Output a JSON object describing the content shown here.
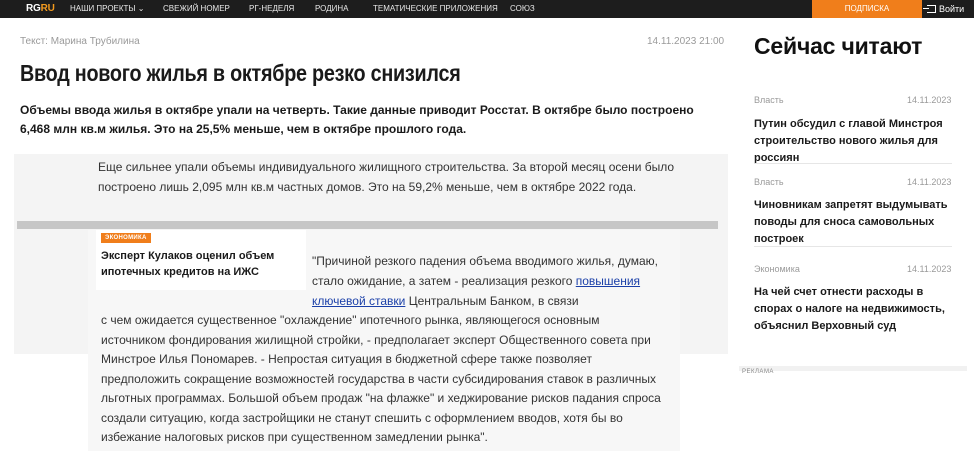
{
  "topnav": {
    "logo_main": "RG",
    "logo_suffix": "RU",
    "items": [
      {
        "label": "НАШИ ПРОЕКТЫ ⌄"
      },
      {
        "label": "СВЕЖИЙ НОМЕР"
      },
      {
        "label": "РГ-НЕДЕЛЯ"
      },
      {
        "label": "РОДИНА"
      },
      {
        "label": "ТЕМАТИЧЕСКИЕ ПРИЛОЖЕНИЯ"
      },
      {
        "label": "СОЮЗ"
      }
    ],
    "subscribe_label": "ПОДПИСКА",
    "login_label": "Войти",
    "colors": {
      "bar": "#1d1d1d",
      "accent": "#f07e1b"
    }
  },
  "article": {
    "author": "Текст: Марина Трубилина",
    "date": "14.11.2023 21:00",
    "title": "Ввод нового жилья в октябре резко снизился",
    "lead": "Объемы ввода жилья в октябре упали на четверть. Такие данные приводит Росстат. В октябре было построено 6,468 млн кв.м жилья. Это на 25,5% меньше, чем в октябре прошлого года.",
    "paragraph1": "Еще сильнее упали объемы индивидуального жилищного строительства. За второй месяц осени было построено лишь 2,095 млн кв.м частных домов. Это на 59,2% меньше, чем в октябре 2022 года.",
    "related": {
      "tag": "ЭКОНОМИКА",
      "title": "Эксперт Кулаков оценил объем ипотечных кредитов на ИЖС"
    },
    "quote_part1": "\"Причиной резкого падения объема вводимого жилья, думаю, стало ожидание, а затем - реализация резкого ",
    "quote_link": "повышения ключевой ставки",
    "quote_part2": " Центральным Банком, в связи",
    "quote_rest": "с чем ожидается существенное \"охлаждение\" ипотечного рынка, являющегося основным источником фондирования жилищной стройки, - предполагает эксперт Общественного совета при Минстрое Илья Пономарев. - Непростая ситуация в бюджетной сфере также позволяет предположить сокращение возможностей государства в части субсидирования ставок в различных льготных программах. Большой объем продаж \"на флажке\" и хеджирование рисков падания спроса создали ситуацию, когда застройщики не станут спешить с оформлением вводов, хотя бы во избежание налоговых рисков при существенном замедлении рынка\"."
  },
  "sidebar": {
    "heading": "Сейчас читают",
    "items": [
      {
        "category": "Власть",
        "date": "14.11.2023",
        "title": "Путин обсудил с главой Минстроя строительство нового жилья для россиян"
      },
      {
        "category": "Власть",
        "date": "14.11.2023",
        "title": "Чиновникам запретят выдумывать поводы для сноса самовольных построек"
      },
      {
        "category": "Экономика",
        "date": "14.11.2023",
        "title": "На чей счет отнести расходы в спорах о налоге на недвижимость, объяснил Верховный суд"
      }
    ],
    "ad_label": "РЕКЛАМА"
  }
}
